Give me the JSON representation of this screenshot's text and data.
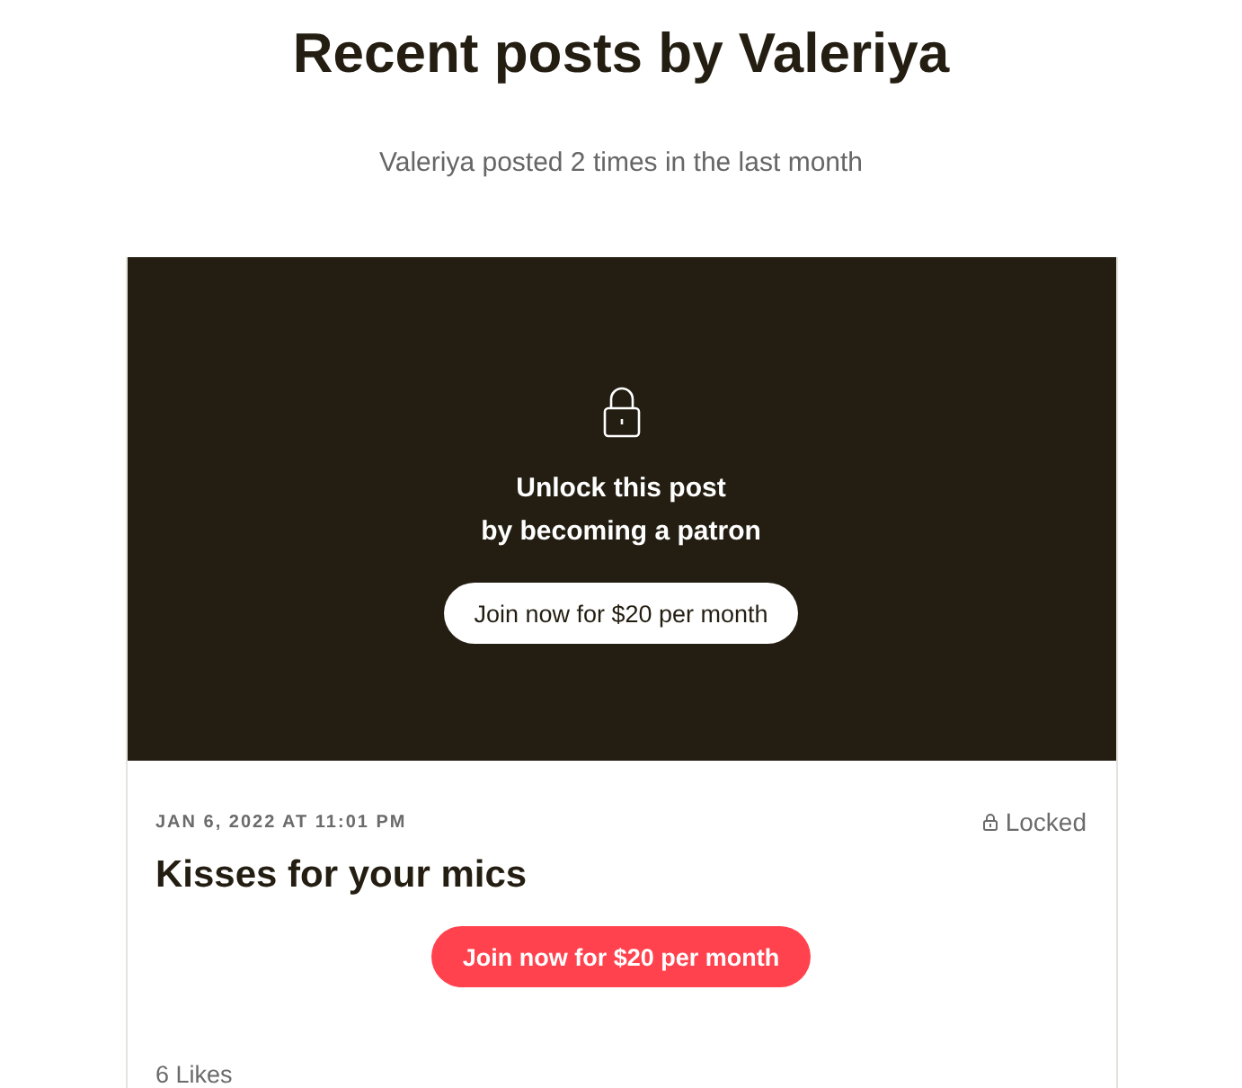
{
  "heading": "Recent posts by Valeriya",
  "subheading": "Valeriya posted 2 times in the last month",
  "post": {
    "locked": true,
    "overlay": {
      "line_1": "Unlock this post",
      "line_2": "by becoming a patron",
      "button": "Join now for $20 per month"
    },
    "date": "JAN 6, 2022 AT 11:01 PM",
    "status": "Locked",
    "title": "Kisses for your mics",
    "join_button": "Join now for $20 per month",
    "likes": "6 Likes"
  }
}
